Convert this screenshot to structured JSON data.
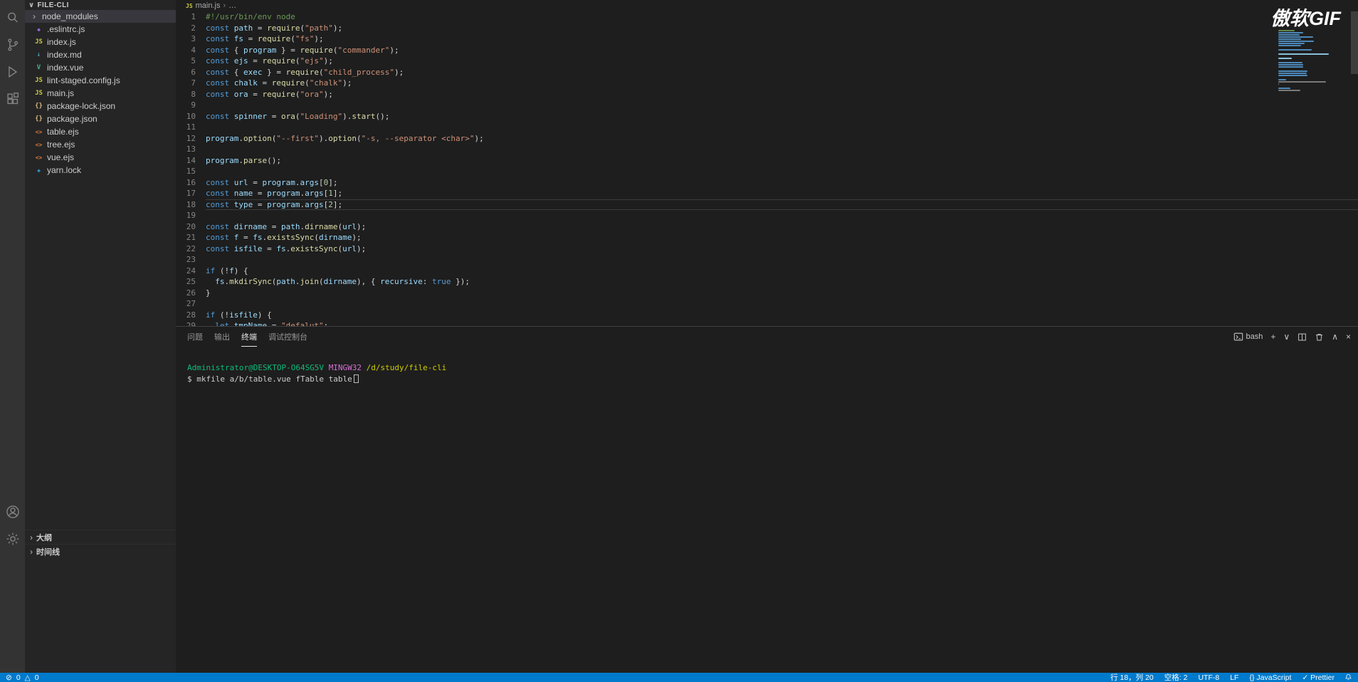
{
  "watermark": "傲软GIF",
  "colors": {
    "status_bar": "#007acc",
    "editor_bg": "#1e1e1e",
    "sidebar_bg": "#252526",
    "activity_bar_bg": "#333333",
    "selection_bg": "#37373d"
  },
  "icon_glyphs": {
    "chevron_down": "∨",
    "chevron_up": "∧",
    "chevron_right": "›",
    "close": "×",
    "plus": "+",
    "js": "JS",
    "md": "↓",
    "vue": "V",
    "json": "{}",
    "ejs": "<>",
    "eslint": "◆",
    "yarn": "◆",
    "error": "⊘",
    "warning": "△"
  },
  "activity_bar": {
    "top_icons": [
      "search",
      "source-control",
      "run-debug",
      "extensions"
    ],
    "bottom_icons": [
      "account",
      "settings"
    ]
  },
  "sidebar": {
    "header": "FILE-CLI",
    "items": [
      {
        "label": "node_modules",
        "icon": "folder",
        "selected": true
      },
      {
        "label": ".eslintrc.js",
        "icon": "eslint"
      },
      {
        "label": "index.js",
        "icon": "js"
      },
      {
        "label": "index.md",
        "icon": "md"
      },
      {
        "label": "index.vue",
        "icon": "vue"
      },
      {
        "label": "lint-staged.config.js",
        "icon": "js"
      },
      {
        "label": "main.js",
        "icon": "js"
      },
      {
        "label": "package-lock.json",
        "icon": "json"
      },
      {
        "label": "package.json",
        "icon": "json"
      },
      {
        "label": "table.ejs",
        "icon": "ejs"
      },
      {
        "label": "tree.ejs",
        "icon": "ejs"
      },
      {
        "label": "vue.ejs",
        "icon": "ejs"
      },
      {
        "label": "yarn.lock",
        "icon": "yarn"
      }
    ],
    "bottom_sections": [
      "大纲",
      "时间线"
    ]
  },
  "editor": {
    "breadcrumb": {
      "file_icon": "JS",
      "file": "main.js",
      "more": "…"
    },
    "active_line": 18,
    "code": {
      "lines": [
        [
          [
            "c",
            "#!/usr/bin/env node"
          ]
        ],
        [
          [
            "k",
            "const "
          ],
          [
            "v",
            "path"
          ],
          [
            "p",
            " = "
          ],
          [
            "f",
            "require"
          ],
          [
            "p",
            "("
          ],
          [
            "s",
            "\"path\""
          ],
          [
            "p",
            ");"
          ]
        ],
        [
          [
            "k",
            "const "
          ],
          [
            "v",
            "fs"
          ],
          [
            "p",
            " = "
          ],
          [
            "f",
            "require"
          ],
          [
            "p",
            "("
          ],
          [
            "s",
            "\"fs\""
          ],
          [
            "p",
            ");"
          ]
        ],
        [
          [
            "k",
            "const "
          ],
          [
            "p",
            "{ "
          ],
          [
            "v",
            "program"
          ],
          [
            "p",
            " } = "
          ],
          [
            "f",
            "require"
          ],
          [
            "p",
            "("
          ],
          [
            "s",
            "\"commander\""
          ],
          [
            "p",
            ");"
          ]
        ],
        [
          [
            "k",
            "const "
          ],
          [
            "v",
            "ejs"
          ],
          [
            "p",
            " = "
          ],
          [
            "f",
            "require"
          ],
          [
            "p",
            "("
          ],
          [
            "s",
            "\"ejs\""
          ],
          [
            "p",
            ");"
          ]
        ],
        [
          [
            "k",
            "const "
          ],
          [
            "p",
            "{ "
          ],
          [
            "v",
            "exec"
          ],
          [
            "p",
            " } = "
          ],
          [
            "f",
            "require"
          ],
          [
            "p",
            "("
          ],
          [
            "s",
            "\"child_process\""
          ],
          [
            "p",
            ");"
          ]
        ],
        [
          [
            "k",
            "const "
          ],
          [
            "v",
            "chalk"
          ],
          [
            "p",
            " = "
          ],
          [
            "f",
            "require"
          ],
          [
            "p",
            "("
          ],
          [
            "s",
            "\"chalk\""
          ],
          [
            "p",
            ");"
          ]
        ],
        [
          [
            "k",
            "const "
          ],
          [
            "v",
            "ora"
          ],
          [
            "p",
            " = "
          ],
          [
            "f",
            "require"
          ],
          [
            "p",
            "("
          ],
          [
            "s",
            "\"ora\""
          ],
          [
            "p",
            ");"
          ]
        ],
        [],
        [
          [
            "k",
            "const "
          ],
          [
            "v",
            "spinner"
          ],
          [
            "p",
            " = "
          ],
          [
            "f",
            "ora"
          ],
          [
            "p",
            "("
          ],
          [
            "s",
            "\"Loading\""
          ],
          [
            "p",
            ")."
          ],
          [
            "f",
            "start"
          ],
          [
            "p",
            "();"
          ]
        ],
        [],
        [
          [
            "v",
            "program"
          ],
          [
            "p",
            "."
          ],
          [
            "f",
            "option"
          ],
          [
            "p",
            "("
          ],
          [
            "s",
            "\"--first\""
          ],
          [
            "p",
            ")."
          ],
          [
            "f",
            "option"
          ],
          [
            "p",
            "("
          ],
          [
            "s",
            "\"-s, --separator <char>\""
          ],
          [
            "p",
            ");"
          ]
        ],
        [],
        [
          [
            "v",
            "program"
          ],
          [
            "p",
            "."
          ],
          [
            "f",
            "parse"
          ],
          [
            "p",
            "();"
          ]
        ],
        [],
        [
          [
            "k",
            "const "
          ],
          [
            "v",
            "url"
          ],
          [
            "p",
            " = "
          ],
          [
            "v",
            "program"
          ],
          [
            "p",
            "."
          ],
          [
            "v",
            "args"
          ],
          [
            "p",
            "["
          ],
          [
            "n",
            "0"
          ],
          [
            "p",
            "];"
          ]
        ],
        [
          [
            "k",
            "const "
          ],
          [
            "v",
            "name"
          ],
          [
            "p",
            " = "
          ],
          [
            "v",
            "program"
          ],
          [
            "p",
            "."
          ],
          [
            "v",
            "args"
          ],
          [
            "p",
            "["
          ],
          [
            "n",
            "1"
          ],
          [
            "p",
            "];"
          ]
        ],
        [
          [
            "k",
            "const "
          ],
          [
            "v",
            "type"
          ],
          [
            "p",
            " = "
          ],
          [
            "v",
            "program"
          ],
          [
            "p",
            "."
          ],
          [
            "v",
            "args"
          ],
          [
            "p",
            "["
          ],
          [
            "n",
            "2"
          ],
          [
            "p",
            "];"
          ]
        ],
        [],
        [
          [
            "k",
            "const "
          ],
          [
            "v",
            "dirname"
          ],
          [
            "p",
            " = "
          ],
          [
            "v",
            "path"
          ],
          [
            "p",
            "."
          ],
          [
            "f",
            "dirname"
          ],
          [
            "p",
            "("
          ],
          [
            "v",
            "url"
          ],
          [
            "p",
            ");"
          ]
        ],
        [
          [
            "k",
            "const "
          ],
          [
            "v",
            "f"
          ],
          [
            "p",
            " = "
          ],
          [
            "v",
            "fs"
          ],
          [
            "p",
            "."
          ],
          [
            "f",
            "existsSync"
          ],
          [
            "p",
            "("
          ],
          [
            "v",
            "dirname"
          ],
          [
            "p",
            ");"
          ]
        ],
        [
          [
            "k",
            "const "
          ],
          [
            "v",
            "isfile"
          ],
          [
            "p",
            " = "
          ],
          [
            "v",
            "fs"
          ],
          [
            "p",
            "."
          ],
          [
            "f",
            "existsSync"
          ],
          [
            "p",
            "("
          ],
          [
            "v",
            "url"
          ],
          [
            "p",
            ");"
          ]
        ],
        [],
        [
          [
            "k",
            "if"
          ],
          [
            "p",
            " (!"
          ],
          [
            "v",
            "f"
          ],
          [
            "p",
            ") {"
          ]
        ],
        [
          [
            "p",
            "  "
          ],
          [
            "v",
            "fs"
          ],
          [
            "p",
            "."
          ],
          [
            "f",
            "mkdirSync"
          ],
          [
            "p",
            "("
          ],
          [
            "v",
            "path"
          ],
          [
            "p",
            "."
          ],
          [
            "f",
            "join"
          ],
          [
            "p",
            "("
          ],
          [
            "v",
            "dirname"
          ],
          [
            "p",
            "), { "
          ],
          [
            "v",
            "recursive"
          ],
          [
            "p",
            ": "
          ],
          [
            "k",
            "true"
          ],
          [
            "p",
            " });"
          ]
        ],
        [
          [
            "p",
            "}"
          ]
        ],
        [],
        [
          [
            "k",
            "if"
          ],
          [
            "p",
            " (!"
          ],
          [
            "v",
            "isfile"
          ],
          [
            "p",
            ") {"
          ]
        ],
        [
          [
            "p",
            "  "
          ],
          [
            "k",
            "let "
          ],
          [
            "v",
            "tmpName"
          ],
          [
            "p",
            " = "
          ],
          [
            "s",
            "\"defalut\""
          ],
          [
            "p",
            ";"
          ]
        ]
      ]
    }
  },
  "panel": {
    "tabs": [
      {
        "id": "problems",
        "label": "问题",
        "active": false
      },
      {
        "id": "output",
        "label": "输出",
        "active": false
      },
      {
        "id": "terminal",
        "label": "终端",
        "active": true
      },
      {
        "id": "debug-console",
        "label": "调试控制台",
        "active": false
      }
    ],
    "shell_label": "bash",
    "terminal": {
      "lines": [
        [
          [
            "g",
            "Administrator@DESKTOP-O64SG5V"
          ],
          [
            "p",
            " "
          ],
          [
            "m",
            "MINGW32"
          ],
          [
            "p",
            " "
          ],
          [
            "y",
            "/d/study/file-cli"
          ]
        ],
        [
          [
            "p",
            "$ mkfile a/b/table.vue fTable table"
          ]
        ]
      ],
      "cursor": true
    }
  },
  "status_bar": {
    "errors": "0",
    "warnings": "0",
    "right": [
      "行 18，列 20",
      "空格: 2",
      "UTF-8",
      "LF",
      "{} JavaScript",
      "✓ Prettier"
    ]
  }
}
